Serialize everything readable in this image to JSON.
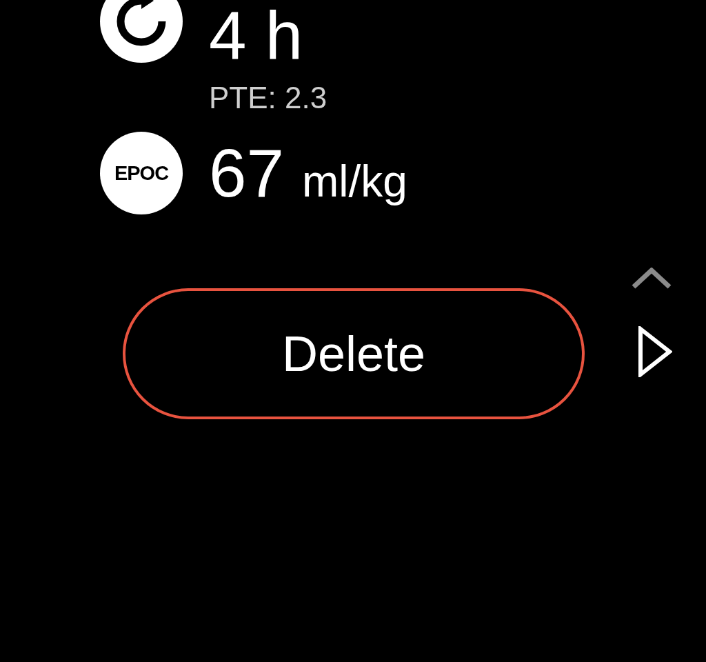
{
  "metrics": [
    {
      "kind": "recovery",
      "value": "4 h",
      "detail": "PTE: 2.3"
    },
    {
      "kind": "epoc",
      "badge": "EPOC",
      "value": "67",
      "unit": "ml/kg"
    }
  ],
  "button": {
    "label": "Delete"
  }
}
